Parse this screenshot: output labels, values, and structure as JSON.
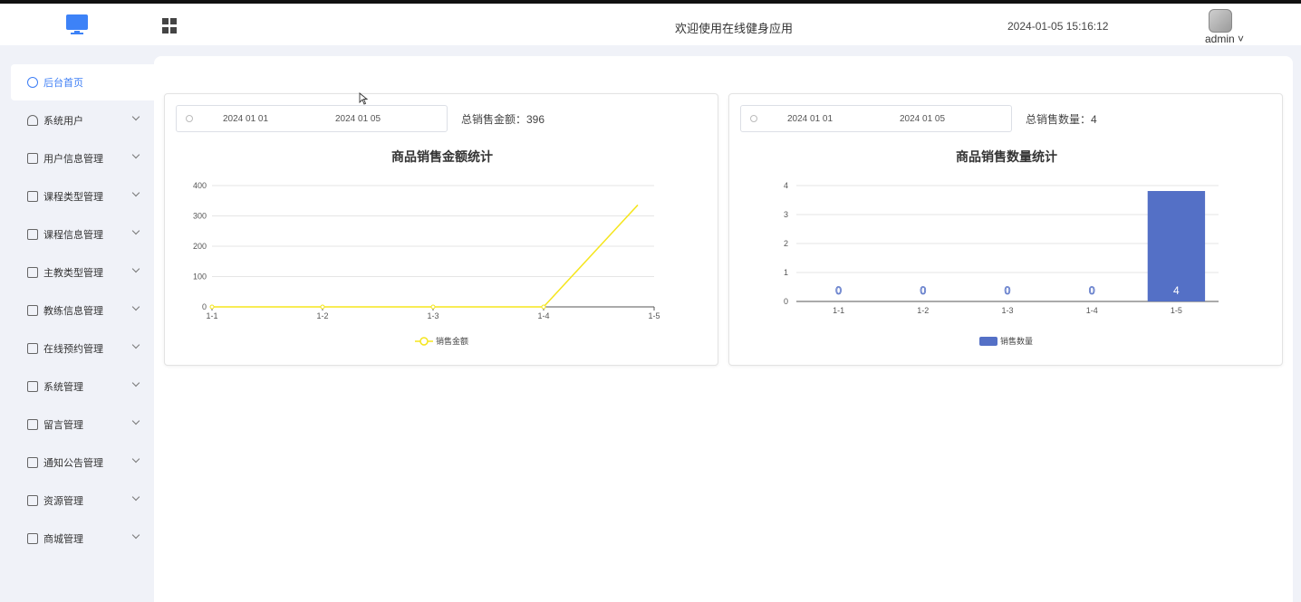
{
  "header": {
    "welcome": "欢迎使用在线健身应用",
    "datetime": "2024-01-05 15:16:12",
    "user": "admin ˅"
  },
  "sidebar": {
    "items": [
      {
        "label": "后台首页",
        "icon": "dashboard-icon",
        "active": true
      },
      {
        "label": "系统用户",
        "icon": "user-icon"
      },
      {
        "label": "用户信息管理",
        "icon": "list-icon"
      },
      {
        "label": "课程类型管理",
        "icon": "list-icon"
      },
      {
        "label": "课程信息管理",
        "icon": "list-icon"
      },
      {
        "label": "主教类型管理",
        "icon": "list-icon"
      },
      {
        "label": "教练信息管理",
        "icon": "list-icon"
      },
      {
        "label": "在线预约管理",
        "icon": "image-icon"
      },
      {
        "label": "系统管理",
        "icon": "folder-icon"
      },
      {
        "label": "留言管理",
        "icon": "folder-icon"
      },
      {
        "label": "通知公告管理",
        "icon": "sparkle-icon"
      },
      {
        "label": "资源管理",
        "icon": "resource-icon"
      },
      {
        "label": "商城管理",
        "icon": "shop-icon"
      }
    ]
  },
  "left_panel": {
    "start_date": "2024 01 01",
    "end_date": "2024 01 05",
    "total_label": "总销售金额：396"
  },
  "right_panel": {
    "start_date": "2024 01 01",
    "end_date": "2024 01 05",
    "total_label": "总销售数量：4"
  },
  "chart_data": [
    {
      "type": "line",
      "title": "商品销售金额统计",
      "categories": [
        "1-1",
        "1-2",
        "1-3",
        "1-4",
        "1-5"
      ],
      "series": [
        {
          "name": "销售金额",
          "values": [
            0,
            0,
            0,
            0,
            336
          ],
          "color": "#f5e51d"
        }
      ],
      "yticks": [
        0,
        100,
        200,
        300,
        400
      ],
      "ylim": [
        0,
        400
      ],
      "grid": true,
      "legend": "bottom"
    },
    {
      "type": "bar",
      "title": "商品销售数量统计",
      "categories": [
        "1-1",
        "1-2",
        "1-3",
        "1-4",
        "1-5"
      ],
      "series": [
        {
          "name": "销售数量",
          "values": [
            0,
            0,
            0,
            0,
            4
          ],
          "color": "#5470c6"
        }
      ],
      "data_labels": [
        "0",
        "0",
        "0",
        "0",
        "4"
      ],
      "yticks": [
        0,
        1,
        2,
        3,
        4
      ],
      "ylim": [
        0,
        4
      ],
      "grid": true,
      "legend": "bottom"
    }
  ]
}
